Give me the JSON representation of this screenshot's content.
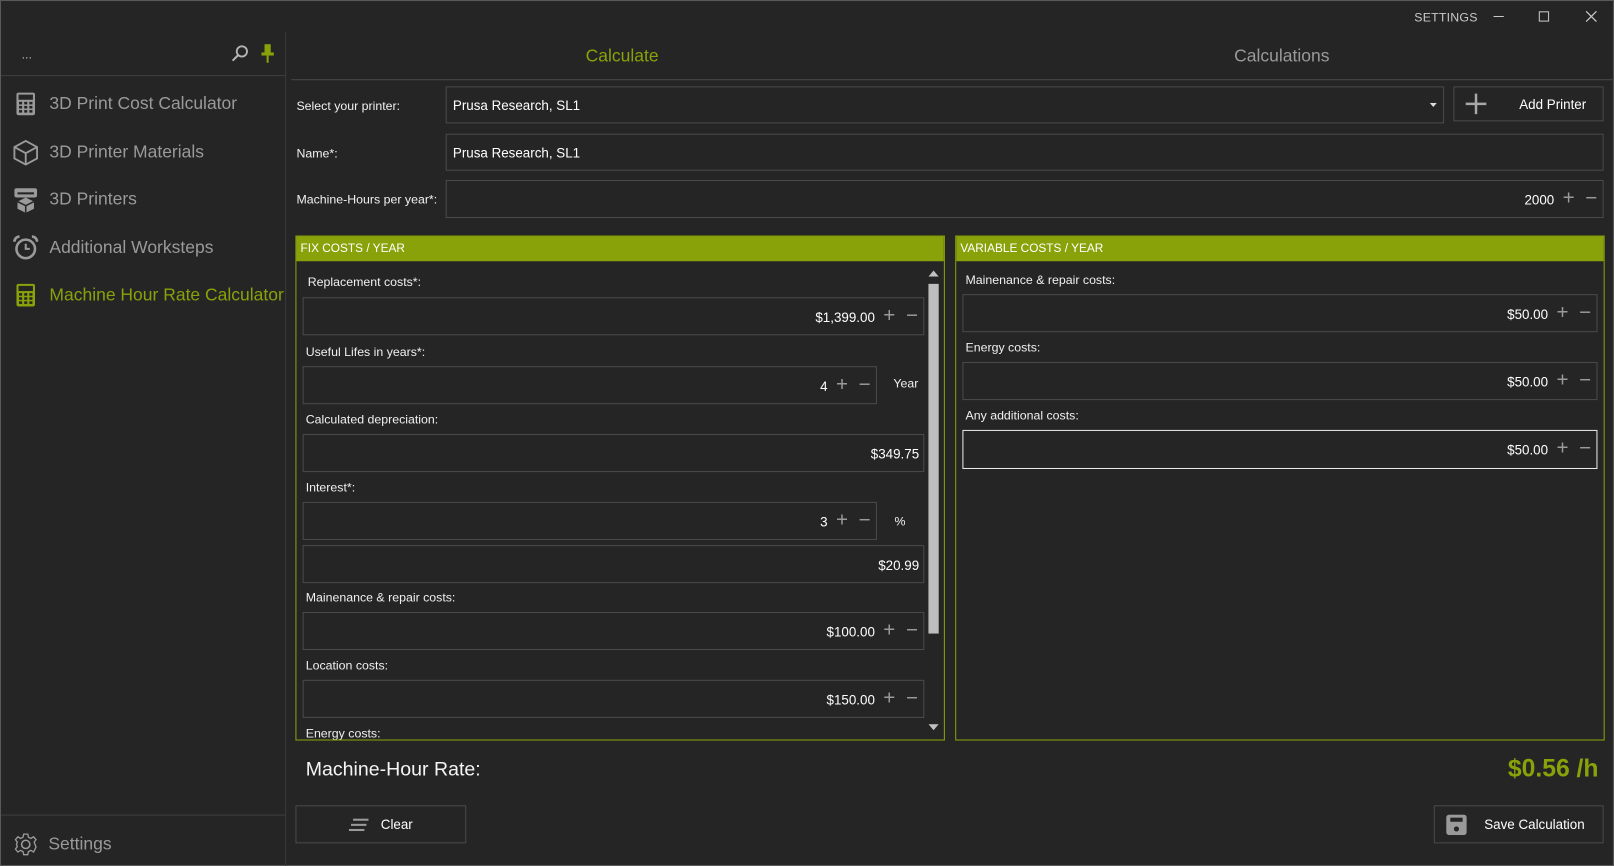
{
  "window": {
    "settings_label": "SETTINGS",
    "minimize_label": "—",
    "maximize_label": "☐",
    "close_label": "✕"
  },
  "sidebar": {
    "header_text": "...",
    "icons": {
      "search": "search-icon",
      "pin": "pin-icon"
    },
    "items": [
      {
        "label": "3D Print Cost Calculator",
        "icon": "calculator-icon",
        "active": false
      },
      {
        "label": "3D Printer Materials",
        "icon": "cube-icon",
        "active": false
      },
      {
        "label": "3D Printers",
        "icon": "printer-icon",
        "active": false
      },
      {
        "label": "Additional Worksteps",
        "icon": "alarm-clock-icon",
        "active": false
      },
      {
        "label": "Machine Hour Rate Calculator",
        "icon": "calculator-icon",
        "active": true
      }
    ],
    "settings_label": "Settings"
  },
  "tabs": [
    {
      "label": "Calculate",
      "active": true
    },
    {
      "label": "Calculations",
      "active": false
    }
  ],
  "form": {
    "printer_label": "Select your printer:",
    "printer_value": "Prusa Research, SL1",
    "add_printer_label": "Add Printer",
    "name_label": "Name*:",
    "name_value": "Prusa Research, SL1",
    "hours_label": "Machine-Hours per year*:",
    "hours_value": "2000"
  },
  "fix_costs": {
    "title": "FIX COSTS / YEAR",
    "replacement_label": "Replacement costs*:",
    "replacement_value": "$1,399.00",
    "useful_life_label": "Useful Lifes in years*:",
    "useful_life_value": "4",
    "useful_life_unit": "Year",
    "depreciation_label": "Calculated depreciation:",
    "depreciation_value": "$349.75",
    "interest_label": "Interest*:",
    "interest_value": "3",
    "interest_unit": "%",
    "interest_amount": "$20.99",
    "maintenance_label": "Mainenance & repair costs:",
    "maintenance_value": "$100.00",
    "location_label": "Location costs:",
    "location_value": "$150.00",
    "energy_label": "Energy costs:"
  },
  "variable_costs": {
    "title": "VARIABLE COSTS / YEAR",
    "maintenance_label": "Mainenance & repair costs:",
    "maintenance_value": "$50.00",
    "energy_label": "Energy costs:",
    "energy_value": "$50.00",
    "additional_label": "Any additional costs:",
    "additional_value": "$50.00"
  },
  "result": {
    "label": "Machine-Hour Rate:",
    "value": "$0.56 /h"
  },
  "actions": {
    "clear_label": "Clear",
    "save_label": "Save Calculation"
  },
  "spinner": {
    "plus": "+",
    "minus": "−"
  },
  "colors": {
    "accent": "#8aa20a",
    "background": "#252525",
    "muted_text": "#9a9a9a"
  }
}
